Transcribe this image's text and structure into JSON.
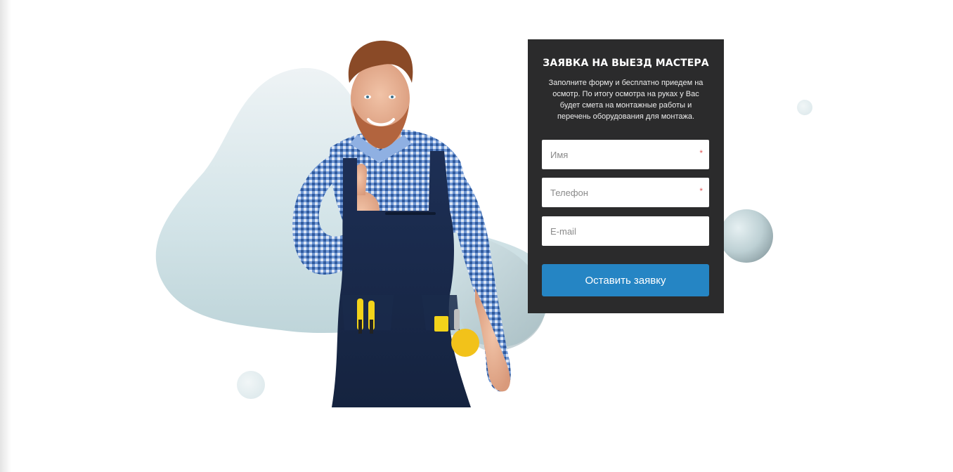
{
  "form": {
    "title": "ЗАЯВКА НА ВЫЕЗД МАСТЕРА",
    "description": "Заполните форму и бесплатно приедем на осмотр. По итогу осмотра на руках у Вас будет смета на монтажные работы и перечень оборудования для монтажа.",
    "fields": [
      {
        "placeholder": "Имя",
        "value": "",
        "required": true,
        "required_mark": "*"
      },
      {
        "placeholder": "Телефон",
        "value": "",
        "required": true,
        "required_mark": "*"
      },
      {
        "placeholder": "E-mail",
        "value": "",
        "required": false,
        "required_mark": ""
      }
    ],
    "submit_label": "Оставить заявку"
  },
  "colors": {
    "card_background": "#2b2b2c",
    "button_background": "#2585c4",
    "required_star": "#e05b5b",
    "blob": "#c9dde3"
  },
  "hero_image": {
    "subject": "smiling-worker-thumbs-up",
    "icon": "worker-photo"
  }
}
